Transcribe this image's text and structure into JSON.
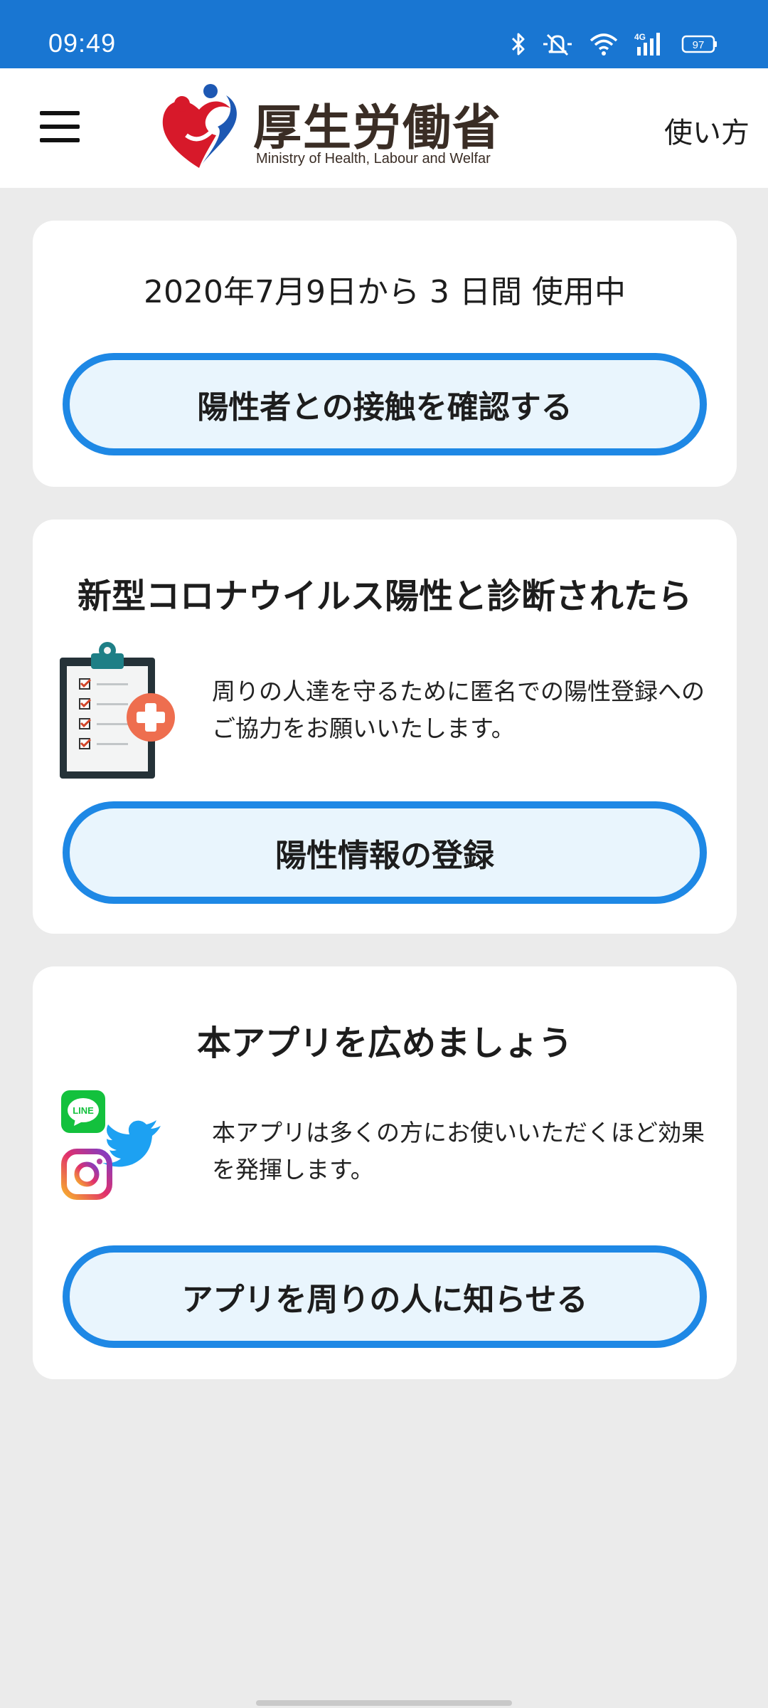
{
  "status_bar": {
    "time": "09:49",
    "battery": "97",
    "network": "4G"
  },
  "header": {
    "brand_name": "厚生労働省",
    "brand_sub": "Ministry of Health, Labour and Welfar",
    "help_label": "使い方"
  },
  "usage": {
    "text": "2020年7月9日から 3 日間 使用中",
    "button_label": "陽性者との接触を確認する"
  },
  "diagnosis": {
    "title": "新型コロナウイルス陽性と診断されたら",
    "description": "周りの人達を守るために匿名での陽性登録へのご協力をお願いいたします。",
    "button_label": "陽性情報の登録"
  },
  "share": {
    "title": "本アプリを広めましょう",
    "description": "本アプリは多くの方にお使いいただくほど効果を発揮します。",
    "button_label": "アプリを周りの人に知らせる",
    "line_label": "LINE"
  },
  "colors": {
    "status_bar": "#1976d2",
    "button_border": "#1e88e5",
    "button_fill": "#e9f5fd",
    "background": "#ebebeb"
  },
  "icons": [
    "bluetooth-icon",
    "mute-icon",
    "wifi-icon",
    "signal-icon",
    "battery-icon",
    "menu-icon",
    "clipboard-icon",
    "line-icon",
    "twitter-icon",
    "instagram-icon"
  ]
}
